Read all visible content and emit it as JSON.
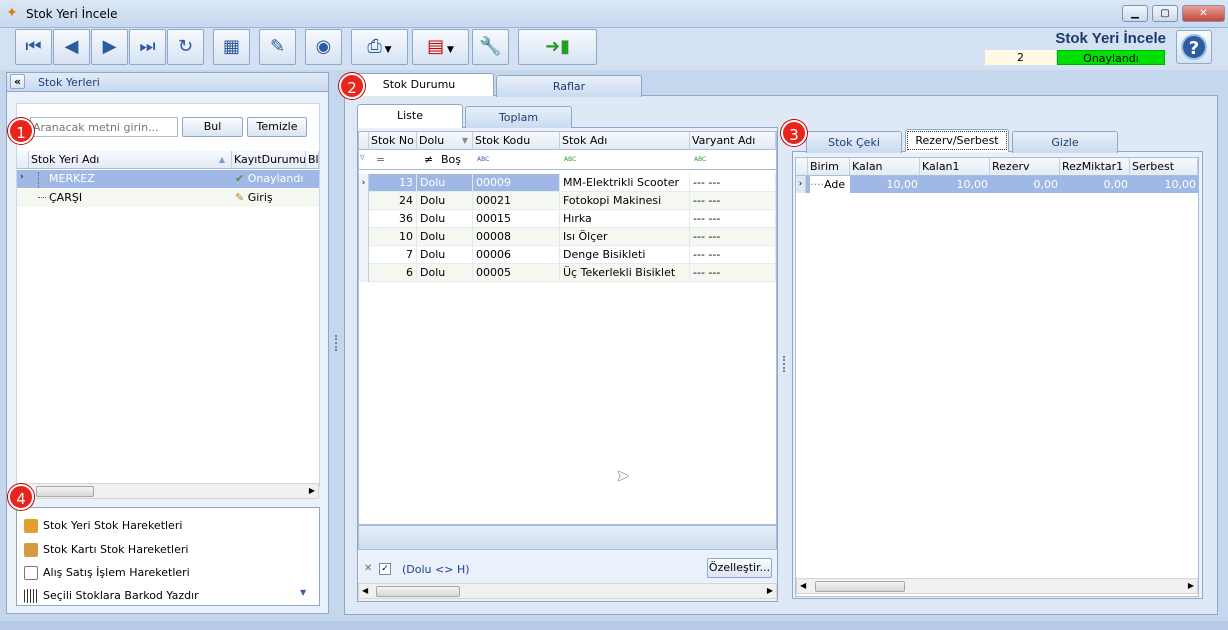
{
  "window": {
    "title": "Stok Yeri İncele",
    "min": "▁",
    "max": "▢",
    "close": "✕"
  },
  "header": {
    "title": "Stok Yeri İncele",
    "record_no": "2",
    "status": "Onaylandı",
    "help": "?"
  },
  "left": {
    "panel_title": "Stok Yerleri",
    "collapse": "«",
    "search_placeholder": "Aranacak metni girin...",
    "find_btn": "Bul",
    "clear_btn": "Temizle",
    "columns": [
      "Stok Yeri Adı",
      "KayıtDurumu",
      "Bl"
    ],
    "rows": [
      {
        "name": "MERKEZ",
        "status": "Onaylandı"
      },
      {
        "name": "ÇARŞI",
        "status": "Giriş"
      }
    ],
    "links": [
      "Stok Yeri Stok Hareketleri",
      "Stok Kartı Stok Hareketleri",
      "Alış Satış İşlem Hareketleri",
      "Seçili Stoklara Barkod Yazdır"
    ]
  },
  "tabs": {
    "main": [
      "Stok Durumu",
      "Raflar"
    ],
    "sub": [
      "Liste",
      "Toplam"
    ],
    "right": [
      "Stok Çeki",
      "Rezerv/Serbest",
      "Gizle"
    ]
  },
  "grid": {
    "columns": [
      "Stok No",
      "Dolu",
      "Stok Kodu",
      "Stok Adı",
      "Varyant Adı"
    ],
    "filter": {
      "stokno": "=",
      "dolu_op": "≠",
      "dolu_val": "Boş",
      "abc": "ABC"
    },
    "rows": [
      {
        "no": "13",
        "dolu": "Dolu",
        "kod": "00009",
        "ad": "MM-Elektrikli Scooter",
        "var": "--- ---"
      },
      {
        "no": "24",
        "dolu": "Dolu",
        "kod": "00021",
        "ad": "Fotokopi Makinesi",
        "var": "--- ---"
      },
      {
        "no": "36",
        "dolu": "Dolu",
        "kod": "00015",
        "ad": "Hırka",
        "var": "--- ---"
      },
      {
        "no": "10",
        "dolu": "Dolu",
        "kod": "00008",
        "ad": "Isı Ölçer",
        "var": "--- ---"
      },
      {
        "no": "7",
        "dolu": "Dolu",
        "kod": "00006",
        "ad": "Denge Bisikleti",
        "var": "--- ---"
      },
      {
        "no": "6",
        "dolu": "Dolu",
        "kod": "00005",
        "ad": "Üç Tekerlekli Bisiklet",
        "var": "--- ---"
      }
    ],
    "filter_text": "(Dolu <> H)",
    "filter_close": "✕",
    "customize_btn": "Özelleştir..."
  },
  "rgrid": {
    "columns": [
      "Birim",
      "Kalan",
      "Kalan1",
      "Rezerv",
      "RezMiktar1",
      "Serbest"
    ],
    "row": {
      "birim": "Ade",
      "kalan": "10,00",
      "kalan1": "10,00",
      "rezerv": "0,00",
      "rezmiktar": "0,00",
      "serbest": "10,00"
    }
  },
  "badges": [
    "1",
    "2",
    "3",
    "4"
  ],
  "colors": {
    "accent": "#0a246a",
    "status_green": "#00e000",
    "selected_row": "#9fb8e6",
    "badge_red": "#e8241c"
  }
}
